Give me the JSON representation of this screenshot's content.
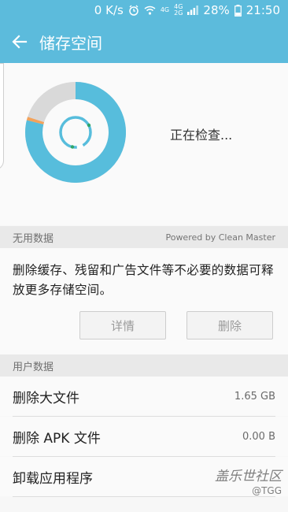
{
  "status_bar": {
    "net_speed": "0 K/s",
    "net_tag_1": "4G",
    "net_tag_2": "4G",
    "net_tag_3": "2G",
    "battery": "28%",
    "time": "21:50",
    "icons": [
      "alarm-icon",
      "wifi-icon",
      "signal-icon",
      "battery-icon"
    ]
  },
  "app_bar": {
    "title": "储存空间",
    "back_icon": "back-arrow-icon"
  },
  "scan": {
    "status_text": "正在检查...",
    "colors": {
      "used": "#57bddc",
      "free": "#d9d9d9",
      "accent": "#f3a25a",
      "inner_indicator": "#2fa66b"
    }
  },
  "unused_section": {
    "header": "无用数据",
    "powered_by": "Powered by Clean Master",
    "description": "删除缓存、残留和广告文件等不必要的数据可释放更多存储空间。",
    "details_button": "详情",
    "delete_button": "删除"
  },
  "user_section": {
    "header": "用户数据",
    "rows": [
      {
        "label": "删除大文件",
        "size": "1.65 GB"
      },
      {
        "label": "删除 APK 文件",
        "size": "0.00 B"
      },
      {
        "label": "卸载应用程序",
        "size": ""
      }
    ]
  },
  "watermark": {
    "main": "盖乐世社区",
    "sub": "@TGG"
  },
  "theme": {
    "primary": "#5cbbdc",
    "section_bg": "#e9e9e9",
    "row_bg": "#fafafa"
  }
}
